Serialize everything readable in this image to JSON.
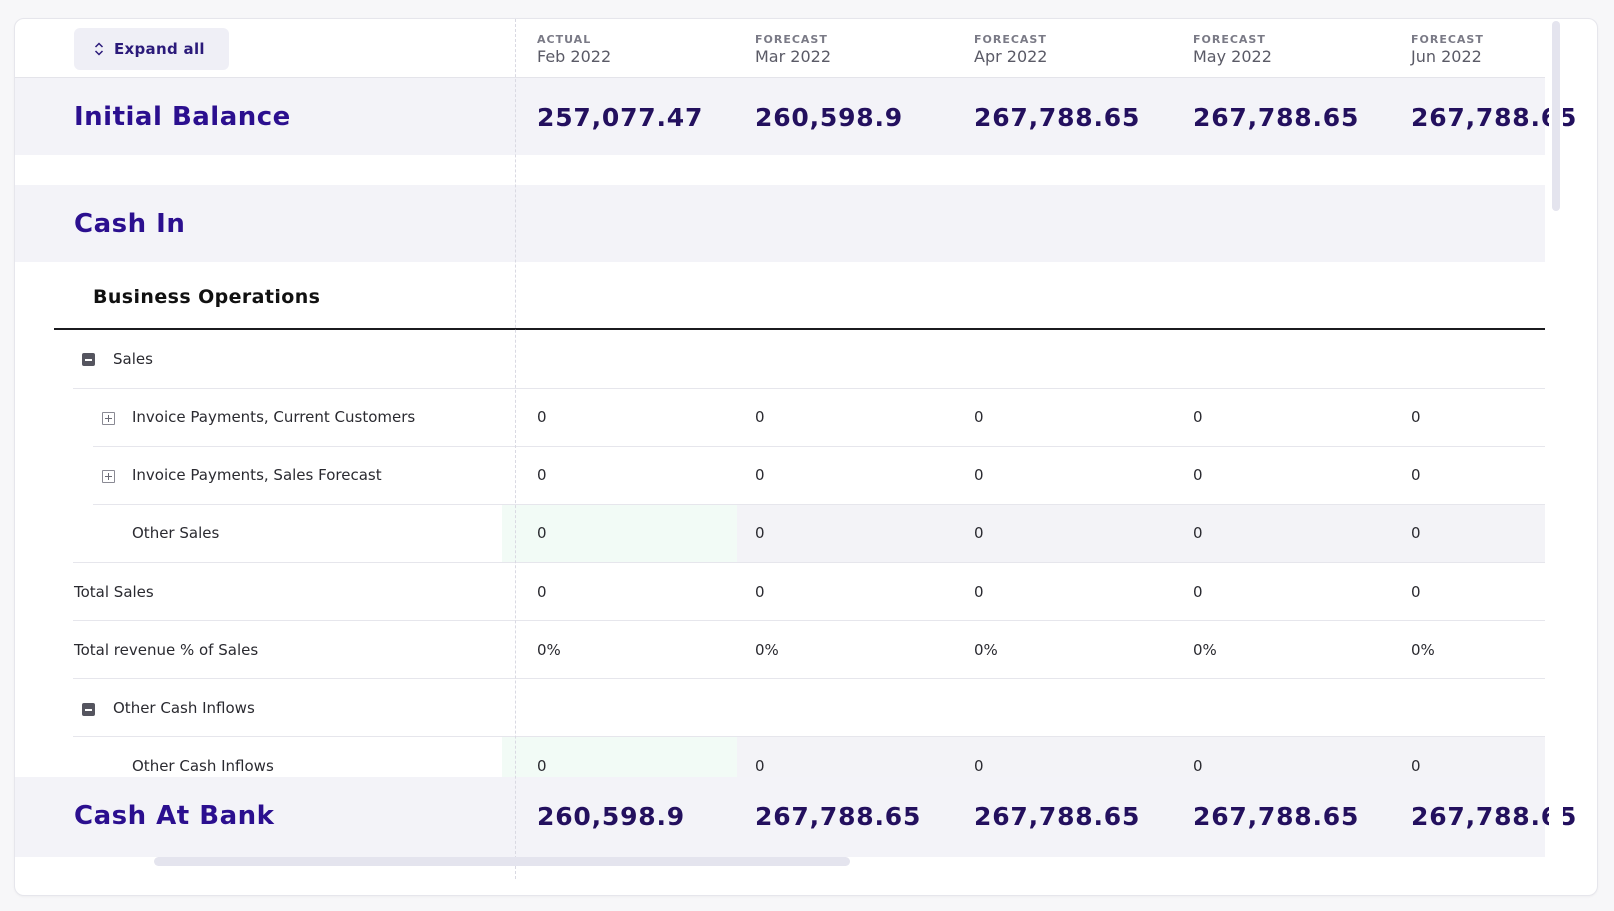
{
  "toolbar": {
    "expand_label": "Expand all"
  },
  "columns": [
    {
      "kind": "ACTUAL",
      "month": "Feb 2022"
    },
    {
      "kind": "FORECAST",
      "month": "Mar 2022"
    },
    {
      "kind": "FORECAST",
      "month": "Apr 2022"
    },
    {
      "kind": "FORECAST",
      "month": "May 2022"
    },
    {
      "kind": "FORECAST",
      "month": "Jun 2022"
    }
  ],
  "initial_balance": {
    "label": "Initial Balance",
    "values": [
      "257,077.47",
      "260,598.9",
      "267,788.65",
      "267,788.65",
      "267,788.65"
    ]
  },
  "cash_in": {
    "label": "Cash In"
  },
  "business_operations": {
    "label": "Business Operations"
  },
  "rows": {
    "sales": {
      "label": "Sales"
    },
    "invoice_current": {
      "label": "Invoice Payments, Current Customers",
      "values": [
        "0",
        "0",
        "0",
        "0",
        "0"
      ]
    },
    "invoice_forecast": {
      "label": "Invoice Payments, Sales Forecast",
      "values": [
        "0",
        "0",
        "0",
        "0",
        "0"
      ]
    },
    "other_sales": {
      "label": "Other Sales",
      "values": [
        "0",
        "0",
        "0",
        "0",
        "0"
      ]
    },
    "total_sales": {
      "label": "Total Sales",
      "values": [
        "0",
        "0",
        "0",
        "0",
        "0"
      ]
    },
    "total_revenue_pct": {
      "label": "Total revenue % of Sales",
      "values": [
        "0%",
        "0%",
        "0%",
        "0%",
        "0%"
      ]
    },
    "other_cash_inflows_group": {
      "label": "Other Cash Inflows"
    },
    "other_cash_inflows": {
      "label": "Other Cash Inflows",
      "values": [
        "0",
        "0",
        "0",
        "0",
        "0"
      ]
    }
  },
  "cash_at_bank": {
    "label": "Cash At Bank",
    "values": [
      "260,598.9",
      "267,788.65",
      "267,788.65",
      "267,788.65",
      "267,788.65"
    ]
  },
  "colors": {
    "accent": "#2b0f8f",
    "number": "#23105e",
    "band": "#f3f3f8",
    "highlight": "#f2fbf6"
  }
}
